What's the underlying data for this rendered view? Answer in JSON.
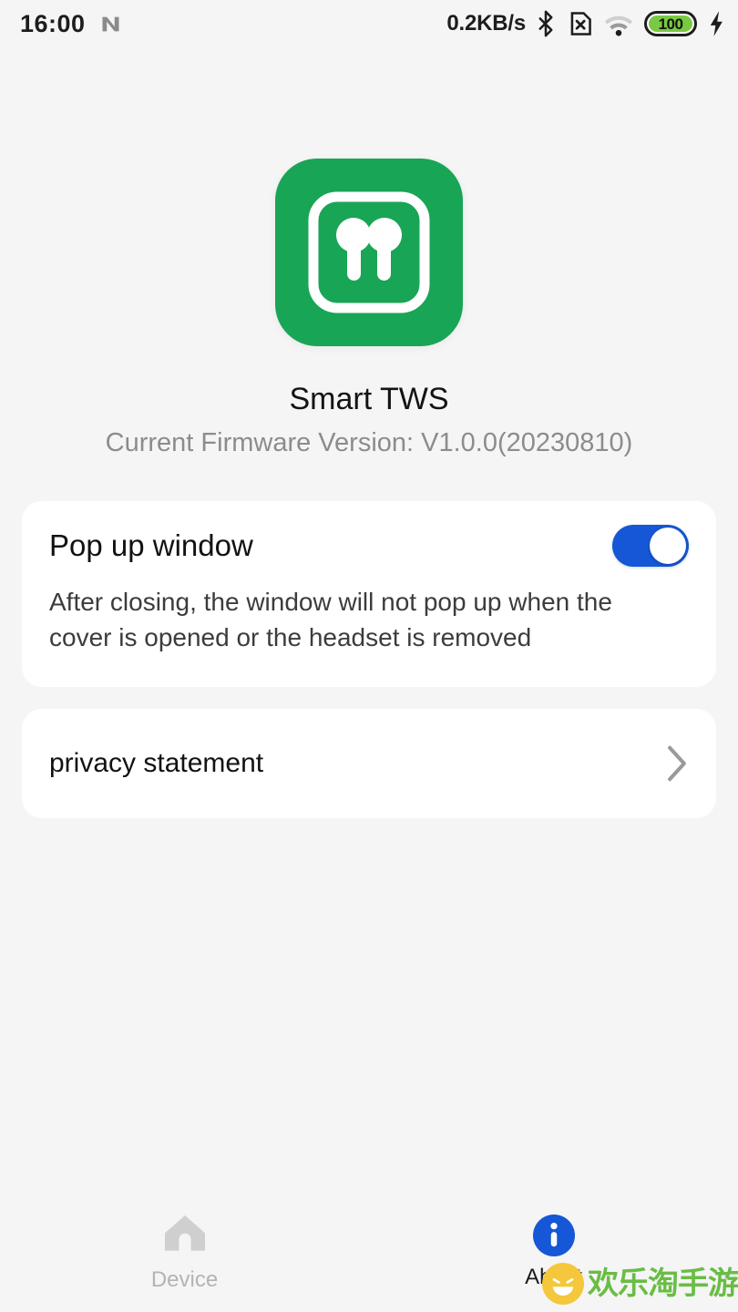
{
  "status_bar": {
    "time": "16:00",
    "nfc_icon": "nfc-n-icon",
    "network_speed": "0.2KB/s",
    "bluetooth_icon": "bluetooth-icon",
    "sim_icon": "sim-card-off-icon",
    "wifi_icon": "wifi-icon",
    "battery_level": "100",
    "charging_icon": "lightning-bolt-icon"
  },
  "app": {
    "icon_name": "earbuds-app-icon",
    "name": "Smart TWS",
    "firmware": "Current Firmware Version: V1.0.0(20230810)"
  },
  "settings": {
    "popup": {
      "title": "Pop up window",
      "description": "After closing, the window will not pop up when the cover is opened or the headset is removed",
      "toggle_state": "on"
    },
    "privacy": {
      "label": "privacy statement",
      "chevron_icon": "chevron-right-icon"
    }
  },
  "bottom_nav": {
    "items": [
      {
        "label": "Device",
        "icon": "home-icon",
        "active": false
      },
      {
        "label": "About",
        "icon": "info-icon",
        "active": true
      }
    ]
  },
  "watermark": {
    "text": "欢乐淘手游",
    "face_icon": "smiley-face-icon"
  },
  "colors": {
    "background": "#f5f5f5",
    "card": "#ffffff",
    "brand_green": "#19a556",
    "accent_blue": "#1557d6",
    "battery_green": "#7ac943",
    "watermark_green": "#69bd45",
    "watermark_yellow": "#f4c73c"
  }
}
